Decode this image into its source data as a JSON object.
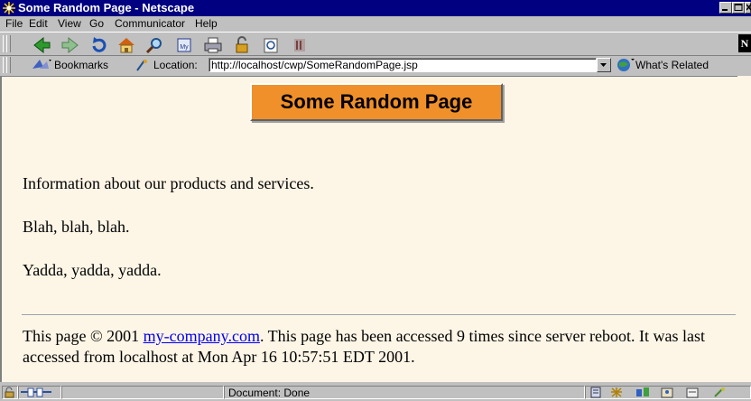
{
  "window": {
    "title": "Some Random Page - Netscape"
  },
  "menu": [
    {
      "label": "File"
    },
    {
      "label": "Edit"
    },
    {
      "label": "View"
    },
    {
      "label": "Go"
    },
    {
      "label": "Communicator"
    },
    {
      "label": "Help"
    }
  ],
  "nav_toolbar": {
    "buttons": [
      "back-icon",
      "forward-icon",
      "reload-icon",
      "home-icon",
      "search-icon",
      "my-netscape-icon",
      "print-icon",
      "security-icon",
      "shop-icon",
      "stop-icon"
    ],
    "brand": "N"
  },
  "location_toolbar": {
    "bookmarks_label": "Bookmarks",
    "location_label": "Location:",
    "url": "http://localhost/cwp/SomeRandomPage.jsp",
    "whats_related_label": "What's Related"
  },
  "page": {
    "heading": "Some Random Page",
    "paragraphs": [
      "Information about our products and services.",
      "Blah, blah, blah.",
      "Yadda, yadda, yadda."
    ],
    "footer_prefix": "This page © 2001 ",
    "footer_link": "my-company.com",
    "footer_suffix": ". This page has been accessed 9 times since server reboot. It was last accessed from localhost at Mon Apr 16 10:57:51 EDT 2001."
  },
  "colors": {
    "title_bar": "#000080",
    "page_background": "#fdf5e6",
    "heading_background": "#f0902a",
    "link": "#0000ee"
  },
  "status": {
    "text": "Document: Done"
  }
}
